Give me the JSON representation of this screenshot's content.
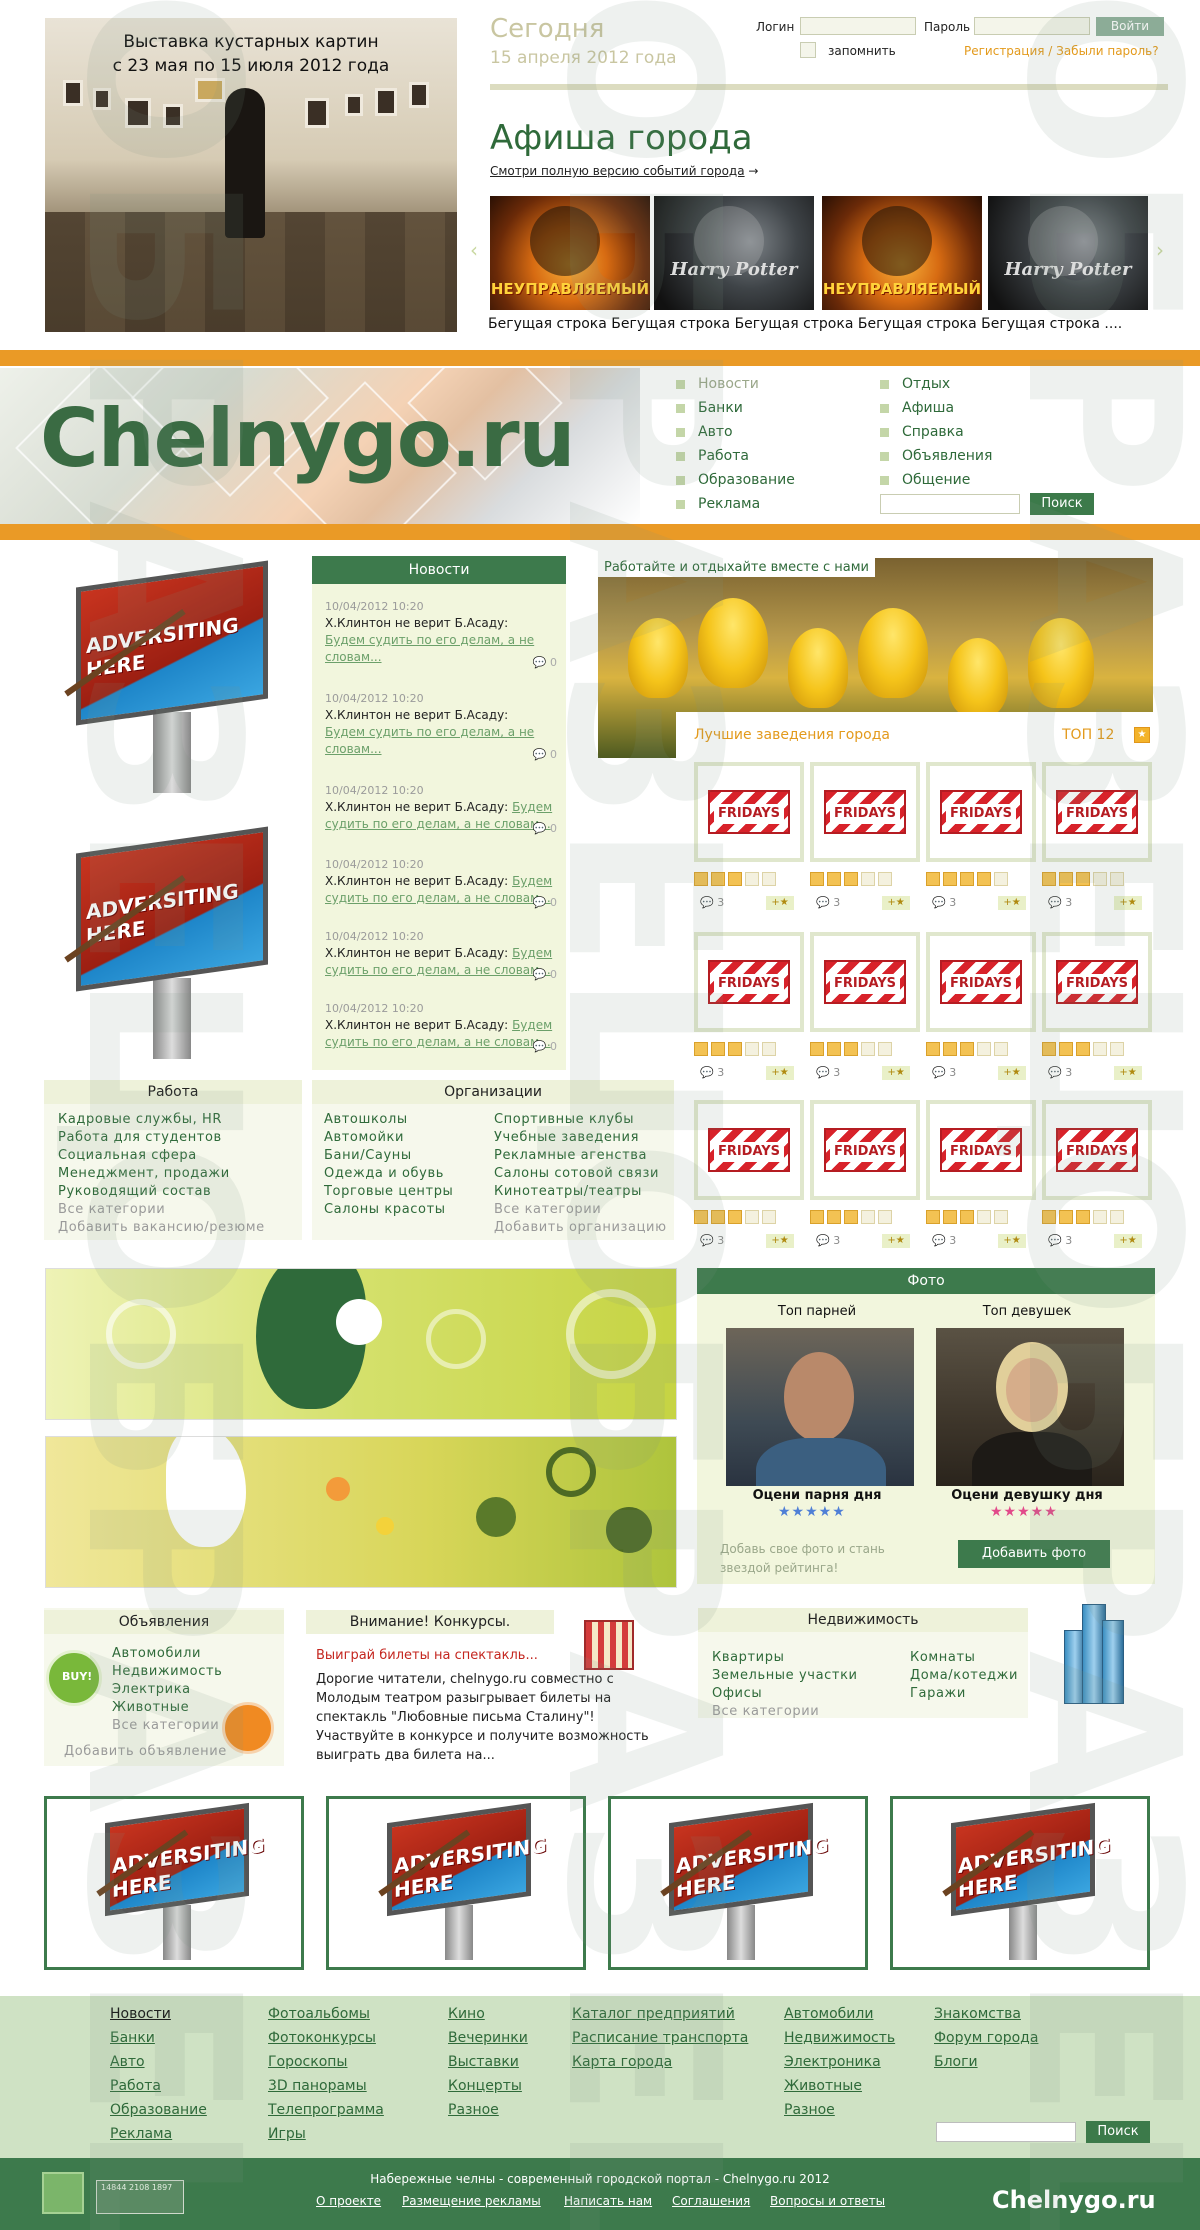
{
  "header": {
    "expo_title_1": "Выставка кустарных картин",
    "expo_title_2": "с 23 мая по 15 июля 2012 года",
    "today_label": "Сегодня",
    "today_date": "15 апреля 2012 года",
    "login_label": "Логин",
    "password_label": "Пароль",
    "login_button": "Войти",
    "remember_label": "запомнить",
    "register_link": "Регистрация / Забыли пароль?",
    "afisha_title": "Афиша города",
    "afisha_full": "Смотри полную версию событий города",
    "afisha_arrow": "→",
    "posters": [
      "НЕУПРАВЛЯЕМЫЙ",
      "Harry Potter",
      "НЕУПРАВЛЯЕМЫЙ",
      "Harry Potter"
    ],
    "ticker": "Бегущая строка Бегущая строка Бегущая строка Бегущая строка Бегущая строка ...."
  },
  "band": {
    "logo": "Chelnygo.ru",
    "menu_left": [
      "Новости",
      "Банки",
      "Авто",
      "Работа",
      "Образование",
      "Реклама"
    ],
    "menu_right": [
      "Отдых",
      "Афиша",
      "Справка",
      "Объявления",
      "Общение"
    ],
    "search_button": "Поиск"
  },
  "ads": {
    "board_text": "ADVERSITING HERE"
  },
  "news": {
    "title": "Новости",
    "items": [
      {
        "date": "10/04/2012  10:20",
        "text": "Х.Клинтон не верит Б.Асаду:",
        "link": "Будем судить по его делам, а не словам...",
        "count": "0"
      },
      {
        "date": "10/04/2012  10:20",
        "text": "Х.Клинтон не верит Б.Асаду:",
        "link": "Будем судить по его делам, а не словам...",
        "count": "0"
      },
      {
        "date": "10/04/2012  10:20",
        "text": "Х.Клинтон не верит Б.Асаду:",
        "link": "Будем судить по его делам, а не словам...",
        "count": "0"
      },
      {
        "date": "10/04/2012  10:20",
        "text": "Х.Клинтон не верит Б.Асаду:",
        "link": "Будем судить по его делам, а не словам...",
        "count": "0"
      },
      {
        "date": "10/04/2012  10:20",
        "text": "Х.Клинтон не верит Б.Асаду:",
        "link": "Будем судить по его делам, а не словам...",
        "count": "0"
      },
      {
        "date": "10/04/2012  10:20",
        "text": "Х.Клинтон не верит Б.Асаду:",
        "link": "Будем судить по его делам, а не словам...",
        "count": "0"
      }
    ]
  },
  "promo": {
    "caption": "Работайте и отдыхайте вместе с нами"
  },
  "best": {
    "title": "Лучшие заведения города",
    "top": "ТОП 12",
    "logo_text": "FRIDAYS",
    "rows": [
      [
        {
          "rating": 3,
          "comments": "3"
        },
        {
          "rating": 3,
          "comments": "3"
        },
        {
          "rating": 4,
          "comments": "3"
        },
        {
          "rating": 3,
          "comments": "3"
        }
      ],
      [
        {
          "rating": 3,
          "comments": "3"
        },
        {
          "rating": 3,
          "comments": "3"
        },
        {
          "rating": 3,
          "comments": "3"
        },
        {
          "rating": 3,
          "comments": "3"
        }
      ],
      [
        {
          "rating": 3,
          "comments": "3"
        },
        {
          "rating": 3,
          "comments": "3"
        },
        {
          "rating": 3,
          "comments": "3"
        },
        {
          "rating": 3,
          "comments": "3"
        }
      ]
    ]
  },
  "work": {
    "title": "Работа",
    "links": [
      "Кадровые службы, HR",
      "Работа для студентов",
      "Социальная сфера",
      "Менеджмент, продажи",
      "Руководящий состав"
    ],
    "all": "Все категории",
    "add": "Добавить вакансию/резюме"
  },
  "orgs": {
    "title": "Организации",
    "col1": [
      "Автошколы",
      "Автомойки",
      "Бани/Сауны",
      "Одежда и обувь",
      "Торговые центры",
      "Салоны красоты"
    ],
    "col2": [
      "Спортивные клубы",
      "Учебные заведения",
      "Рекламные агенства",
      "Салоны сотовой связи",
      "Кинотеатры/театры"
    ],
    "all": "Все категории",
    "add": "Добавить организацию"
  },
  "photo": {
    "title": "Фото",
    "top_men": "Топ парней",
    "top_women": "Топ девушек",
    "rate_man": "Оцени парня дня",
    "rate_woman": "Оцени девушку дня",
    "add_text": "Добавь свое фото и стань звездой рейтинга!",
    "add_button": "Добавить фото"
  },
  "classifieds": {
    "title": "Объявления",
    "links": [
      "Автомобили",
      "Недвижимость",
      "Электрика",
      "Животные"
    ],
    "all": "Все категории",
    "add": "Добавить объявление"
  },
  "contest": {
    "title": "Внимание! Конкурсы.",
    "headline": "Выиграй билеты на спектакль...",
    "text": "Дорогие читатели, chelnygo.ru совместно с Молодым театром разыгрывает билеты на спектакль \"Любовные письма Сталину\"! Участвуйте в конкурсе и получите возможность выиграть два билета на..."
  },
  "estate": {
    "title": "Недвижимость",
    "col1": [
      "Квартиры",
      "Земельные участки",
      "Офисы"
    ],
    "col2": [
      "Комнаты",
      "Дома/котеджи",
      "Гаражи"
    ],
    "all": "Все категории"
  },
  "footer": {
    "col1": [
      "Новости",
      "Банки",
      "Авто",
      "Работа",
      "Образование",
      "Реклама"
    ],
    "col2": [
      "Фотоальбомы",
      "Фотоконкурсы",
      "Гороскопы",
      "3D панорамы",
      "Телепрограмма",
      "Игры"
    ],
    "col3": [
      "Кино",
      "Вечеринки",
      "Выставки",
      "Концерты",
      "Разное"
    ],
    "col4": [
      "Каталог предприятий",
      "Расписание транспорта",
      "Карта города"
    ],
    "col5": [
      "Автомобили",
      "Недвижимость",
      "Электроника",
      "Животные",
      "Разное"
    ],
    "col6": [
      "Знакомства",
      "Форум города",
      "Блоги"
    ],
    "search_button": "Поиск",
    "copyright": "Набережные челны - современный городской портал - Chelnygo.ru 2012",
    "bottom_links": [
      "О проекте",
      "Размещение рекламы",
      "Написать нам",
      "Соглашения",
      "Вопросы и ответы"
    ],
    "logo": "Chelnygo.ru",
    "counter_text": "14844 2108 1897"
  },
  "watermark": "ОБРАЗЕЦ",
  "colors": {
    "brand_green": "#3d7a4c",
    "accent_orange": "#ea9a26",
    "light_green": "#f2f6dd"
  }
}
